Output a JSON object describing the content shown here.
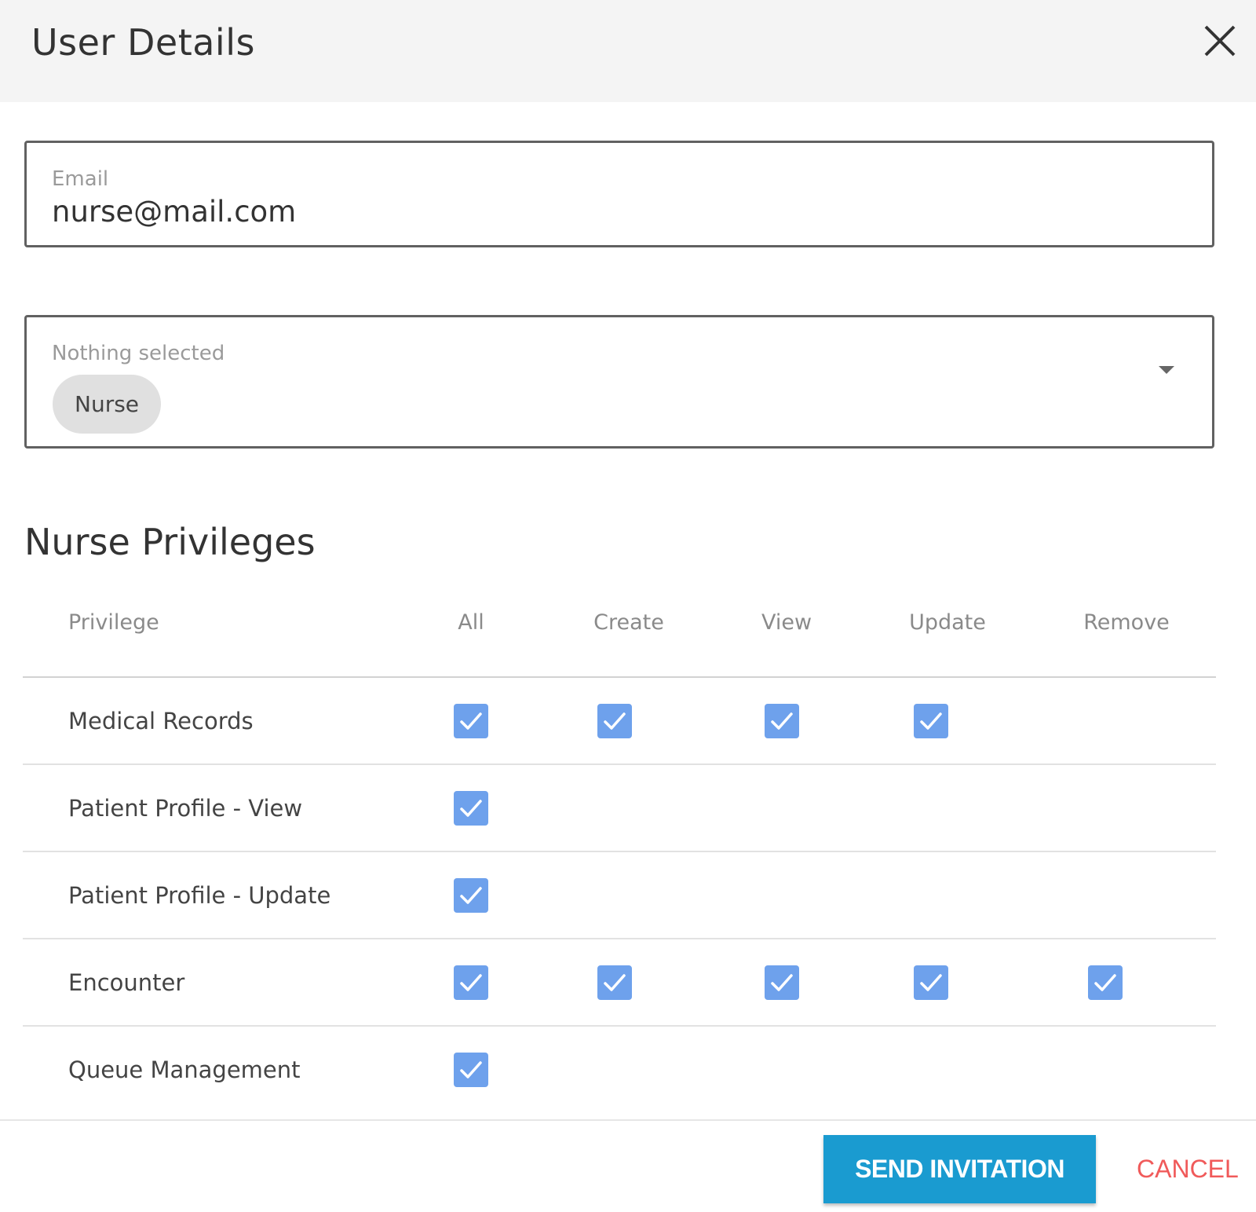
{
  "dialog": {
    "title": "User Details"
  },
  "email_field": {
    "label": "Email",
    "value": "nurse@mail.com"
  },
  "role_field": {
    "label": "Nothing selected",
    "selected_chip": "Nurse"
  },
  "privileges": {
    "title": "Nurse Privileges",
    "columns": [
      "Privilege",
      "All",
      "Create",
      "View",
      "Update",
      "Remove"
    ],
    "rows": [
      {
        "name": "Medical Records",
        "checked": [
          true,
          true,
          true,
          true,
          false
        ]
      },
      {
        "name": "Patient Profile - View",
        "checked": [
          true,
          false,
          false,
          false,
          false
        ]
      },
      {
        "name": "Patient Profile - Update",
        "checked": [
          true,
          false,
          false,
          false,
          false
        ]
      },
      {
        "name": "Encounter",
        "checked": [
          true,
          true,
          true,
          true,
          true
        ]
      },
      {
        "name": "Queue Management",
        "checked": [
          true,
          false,
          false,
          false,
          false
        ]
      }
    ]
  },
  "actions": {
    "send_label": "SEND INVITATION",
    "cancel_label": "CANCEL"
  },
  "colors": {
    "checkbox": "#6ea1ec",
    "send_button": "#1a9bd0",
    "cancel_text": "#f05a5a"
  },
  "icons": {
    "close": "close-icon",
    "dropdown": "chevron-down-icon",
    "check": "checkmark-icon"
  }
}
